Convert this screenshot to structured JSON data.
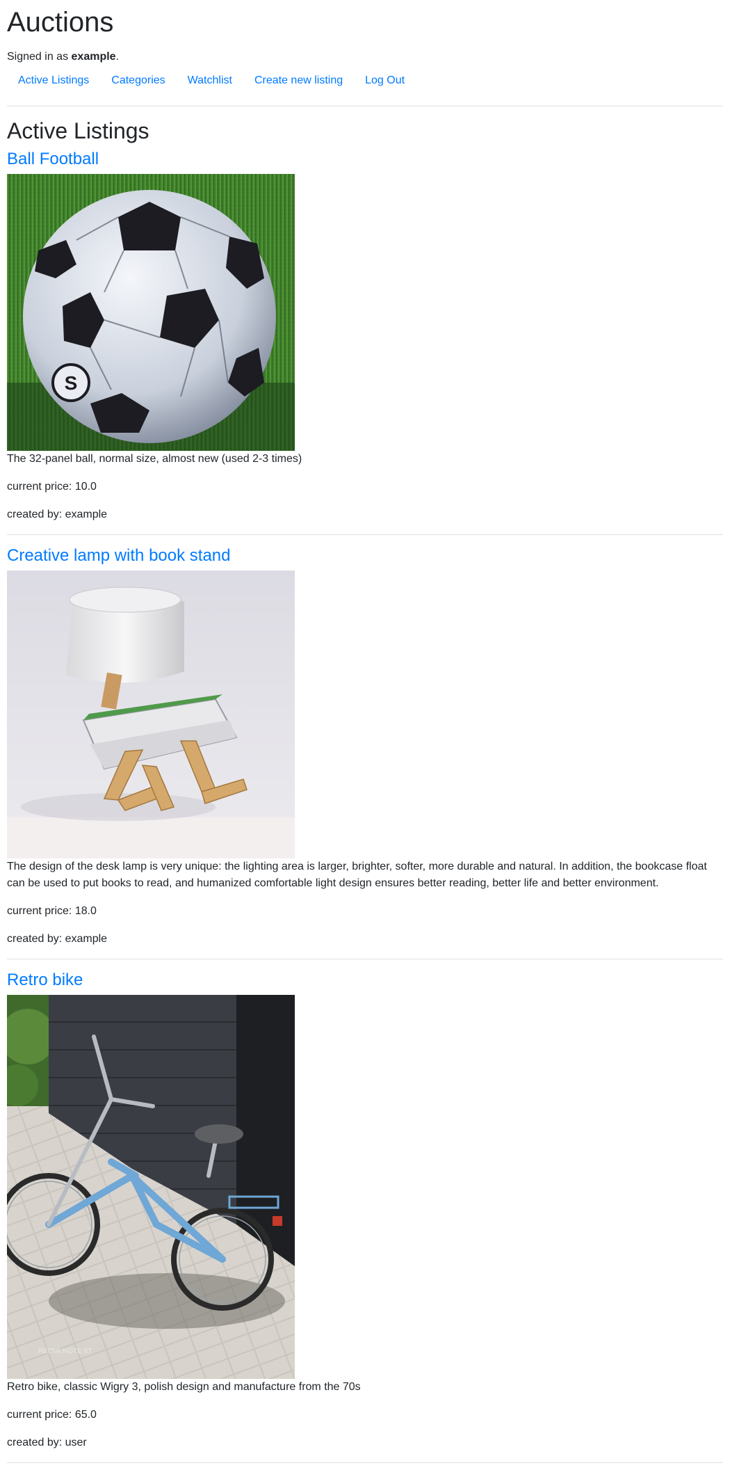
{
  "site": {
    "title": "Auctions",
    "signed_in_prefix": "Signed in as ",
    "username": "example",
    "signed_in_suffix": "."
  },
  "nav": {
    "items": [
      {
        "label": "Active Listings"
      },
      {
        "label": "Categories"
      },
      {
        "label": "Watchlist"
      },
      {
        "label": "Create new listing"
      },
      {
        "label": "Log Out"
      }
    ]
  },
  "page": {
    "title": "Active Listings"
  },
  "listings": [
    {
      "title": "Ball Football",
      "image_icon": "soccer-ball-photo",
      "description": "The 32-panel ball, normal size, almost new (used 2-3 times)",
      "price_text": "current price: 10.0",
      "creator_text": "created by: example"
    },
    {
      "title": "Creative lamp with book stand",
      "image_icon": "desk-lamp-photo",
      "description": "The design of the desk lamp is very unique: the lighting area is larger, brighter, softer, more durable and natural. In addition, the bookcase float can be used to put books to read, and humanized comfortable light design ensures better reading, better life and better environment.",
      "price_text": "current price: 18.0",
      "creator_text": "created by: example"
    },
    {
      "title": "Retro bike",
      "image_icon": "retro-bike-photo",
      "description": "Retro bike, classic Wigry 3, polish design and manufacture from the 70s",
      "price_text": "current price: 65.0",
      "creator_text": "created by: user"
    }
  ]
}
